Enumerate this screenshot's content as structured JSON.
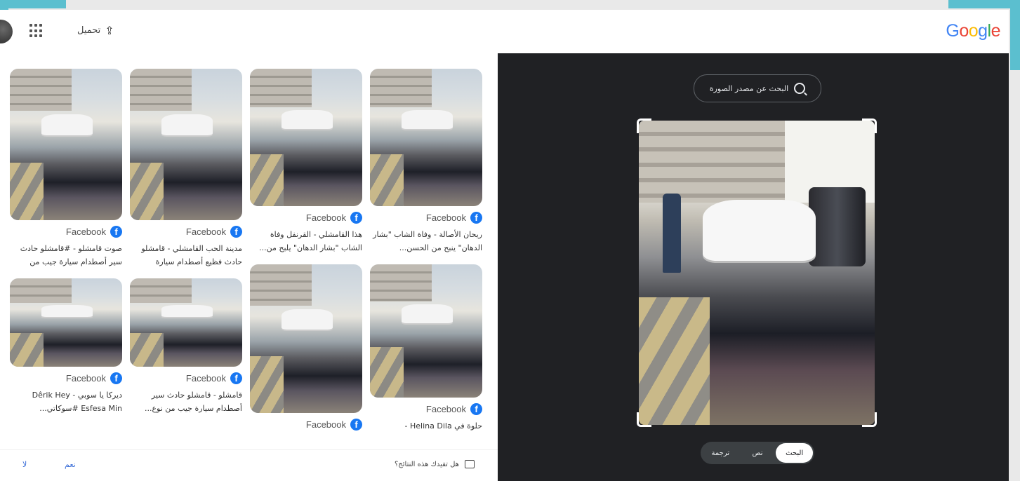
{
  "header": {
    "upload_label": "تحميل",
    "logo": {
      "G": "G",
      "o1": "o",
      "o2": "o",
      "g": "g",
      "l": "l",
      "e": "e"
    }
  },
  "preview": {
    "find_source_label": "البحث عن مصدر الصورة",
    "modes": [
      {
        "label": "البحث",
        "active": true
      },
      {
        "label": "نص",
        "active": false
      },
      {
        "label": "ترجمة",
        "active": false
      }
    ]
  },
  "results": {
    "columns": [
      [
        {
          "source": "Facebook",
          "caption": "ريحان الأصالة - وفاة الشاب \"بشار الدهان\" ينبح من الحسن..."
        },
        {
          "source": "Facebook",
          "caption": "حلوة في Helina Dila -"
        }
      ],
      [
        {
          "source": "Facebook",
          "caption": "هذا القامشلي - القرنفل وفاة الشاب \"بشار الدهان\" يلبح من..."
        },
        {
          "source": "Facebook",
          "caption": ""
        }
      ],
      [
        {
          "source": "Facebook",
          "caption": "مدينة الحب القامشلي - قامشلو حادث فظيع أصطدام سيارة مسرعة..."
        },
        {
          "source": "Facebook",
          "caption": "قامشلو - قامشلو حادث سير أصطدام سيارة جيب من نوع..."
        }
      ],
      [
        {
          "source": "Facebook",
          "caption": "صوت قامشلو - #قامشلو حادث سير أصطدام سيارة جيب من نوع..."
        },
        {
          "source": "Facebook",
          "caption": "ديركا يا سوبي Dêrik Hey - Esfesa Min #سوكاتي..."
        }
      ]
    ]
  },
  "feedback": {
    "question": "هل تفيدك هذه النتائج؟",
    "yes_label": "نعم",
    "no_label": "لا"
  },
  "colors": {
    "accent_teal": "#5bbfcf",
    "facebook_blue": "#1877f2",
    "preview_bg": "#202124"
  }
}
